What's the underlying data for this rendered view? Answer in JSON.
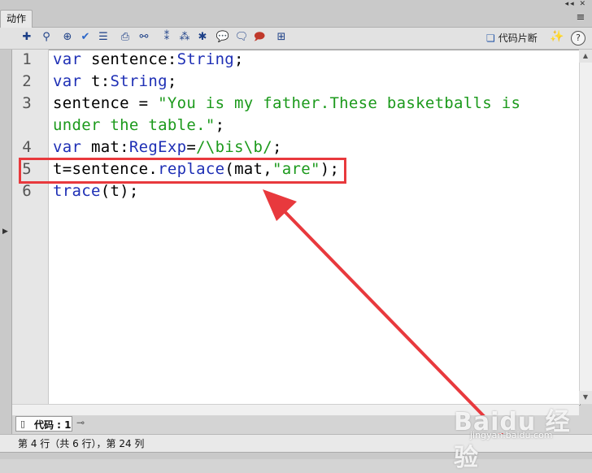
{
  "panel": {
    "title": "动作",
    "controls": "◂◂ ✕",
    "menu": "≡"
  },
  "toolbar": {
    "snippets_label": "代码片断",
    "help": "?"
  },
  "editor": {
    "line_numbers": [
      "1",
      "2",
      "3",
      "",
      "4",
      "5",
      "6"
    ],
    "lines": [
      {
        "num": "1",
        "parts": [
          [
            "kw",
            "var"
          ],
          [
            "p",
            " sentence:"
          ],
          [
            "ty",
            "String"
          ],
          [
            "p",
            ";"
          ]
        ]
      },
      {
        "num": "2",
        "parts": [
          [
            "kw",
            "var"
          ],
          [
            "p",
            " t:"
          ],
          [
            "ty",
            "String"
          ],
          [
            "p",
            ";"
          ]
        ]
      },
      {
        "num": "3",
        "parts": [
          [
            "p",
            "sentence = "
          ],
          [
            "str",
            "\"You is my father.These basketballs is"
          ]
        ]
      },
      {
        "num": "",
        "parts": [
          [
            "str",
            "under the table.\""
          ],
          [
            "p",
            ";"
          ]
        ]
      },
      {
        "num": "4",
        "parts": [
          [
            "kw",
            "var"
          ],
          [
            "p",
            " mat:"
          ],
          [
            "ty",
            "RegExp"
          ],
          [
            "p",
            "="
          ],
          [
            "str",
            "/\\bis\\b/"
          ],
          [
            "p",
            ";"
          ]
        ]
      },
      {
        "num": "5",
        "parts": [
          [
            "p",
            "t=sentence."
          ],
          [
            "fn",
            "replace"
          ],
          [
            "p",
            "(mat,"
          ],
          [
            "str",
            "\"are\""
          ],
          [
            "p",
            ");"
          ]
        ]
      },
      {
        "num": "6",
        "parts": [
          [
            "fn",
            "trace"
          ],
          [
            "p",
            "(t);"
          ]
        ]
      }
    ]
  },
  "tab": {
    "label": "代码 : 1"
  },
  "status": {
    "text": "第 4 行（共 6 行），第 24 列"
  },
  "watermark": {
    "logo": "Baidu 经验",
    "url": "jingyan.baidu.com"
  },
  "colors": {
    "keyword": "#1e2fb5",
    "string": "#1c9a1c",
    "annotation": "#e8393d"
  }
}
